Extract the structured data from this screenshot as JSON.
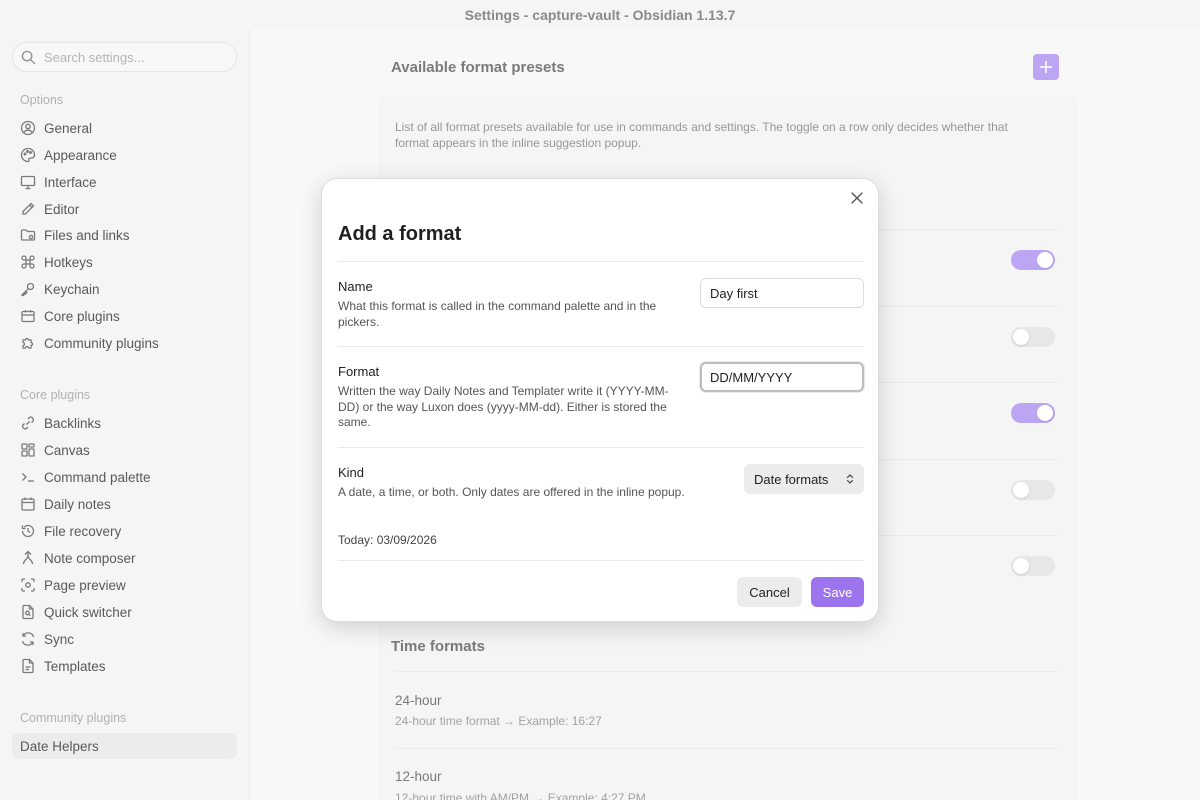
{
  "window": {
    "title": "Settings - capture-vault - Obsidian 1.13.7"
  },
  "sidebar": {
    "search_placeholder": "Search settings...",
    "options_heading": "Options",
    "options": [
      {
        "label": "General",
        "icon": "user-circle-icon"
      },
      {
        "label": "Appearance",
        "icon": "palette-icon"
      },
      {
        "label": "Interface",
        "icon": "monitor-icon"
      },
      {
        "label": "Editor",
        "icon": "pen-icon"
      },
      {
        "label": "Files and links",
        "icon": "folder-icon"
      },
      {
        "label": "Hotkeys",
        "icon": "command-icon"
      },
      {
        "label": "Keychain",
        "icon": "key-icon"
      },
      {
        "label": "Core plugins",
        "icon": "plugin-icon"
      },
      {
        "label": "Community plugins",
        "icon": "puzzle-icon"
      }
    ],
    "core_heading": "Core plugins",
    "core": [
      {
        "label": "Backlinks",
        "icon": "backlink-icon"
      },
      {
        "label": "Canvas",
        "icon": "canvas-icon"
      },
      {
        "label": "Command palette",
        "icon": "terminal-icon"
      },
      {
        "label": "Daily notes",
        "icon": "calendar-icon"
      },
      {
        "label": "File recovery",
        "icon": "history-icon"
      },
      {
        "label": "Note composer",
        "icon": "merge-icon"
      },
      {
        "label": "Page preview",
        "icon": "preview-icon"
      },
      {
        "label": "Quick switcher",
        "icon": "file-search-icon"
      },
      {
        "label": "Sync",
        "icon": "sync-icon"
      },
      {
        "label": "Templates",
        "icon": "template-icon"
      }
    ],
    "community_heading": "Community plugins",
    "community": [
      {
        "label": "Date Helpers"
      }
    ]
  },
  "main": {
    "heading": "Available format presets",
    "description": "List of all format presets available for use in commands and settings. The toggle on a row only decides whether that format appears in the inline suggestion popup.",
    "toggles": [
      true,
      false,
      true,
      false,
      false
    ],
    "time_heading": "Time formats",
    "time_rows": [
      {
        "title": "24-hour",
        "desc": "24-hour time format → Example: 16:27"
      },
      {
        "title": "12-hour",
        "desc": "12-hour time with AM/PM → Example: 4:27 PM"
      }
    ]
  },
  "modal": {
    "title": "Add a format",
    "name_label": "Name",
    "name_desc": "What this format is called in the command palette and in the pickers.",
    "name_value": "Day first",
    "format_label": "Format",
    "format_desc": "Written the way Daily Notes and Templater write it (YYYY-MM-DD) or the way Luxon does (yyyy-MM-dd). Either is stored the same.",
    "format_value": "DD/MM/YYYY",
    "kind_label": "Kind",
    "kind_desc": "A date, a time, or both. Only dates are offered in the inline popup.",
    "kind_value": "Date formats",
    "today": "Today: 03/09/2026",
    "cancel": "Cancel",
    "save": "Save"
  },
  "colors": {
    "accent": "#9b74ee",
    "accent_light": "#a98ef0"
  }
}
